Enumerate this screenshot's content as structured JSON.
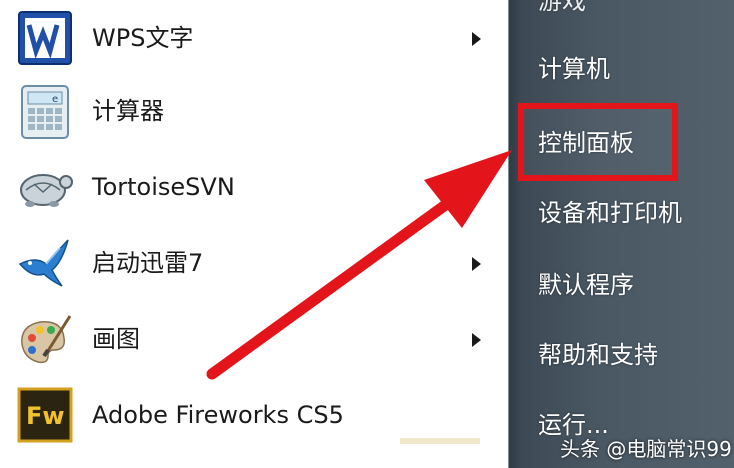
{
  "programs": [
    {
      "label": "WPS文字",
      "icon": "wps-writer-icon",
      "has_submenu": true
    },
    {
      "label": "计算器",
      "icon": "calculator-icon",
      "has_submenu": false
    },
    {
      "label": "TortoiseSVN",
      "icon": "tortoise-icon",
      "has_submenu": false
    },
    {
      "label": "启动迅雷7",
      "icon": "thunder-bird-icon",
      "has_submenu": true
    },
    {
      "label": "画图",
      "icon": "paint-palette-icon",
      "has_submenu": true
    },
    {
      "label": "Adobe Fireworks CS5",
      "icon": "fireworks-icon",
      "icon_text": "Fw",
      "has_submenu": false
    }
  ],
  "right_menu": {
    "partial_top": "游戏",
    "items": [
      "计算机",
      "控制面板",
      "设备和打印机",
      "默认程序",
      "帮助和支持",
      "运行..."
    ],
    "highlighted": "控制面板"
  },
  "watermark": "头条 @电脑常识99",
  "colors": {
    "highlight": "#e3151b",
    "arrow": "#e3151b",
    "right_pane": "#4a5864"
  }
}
